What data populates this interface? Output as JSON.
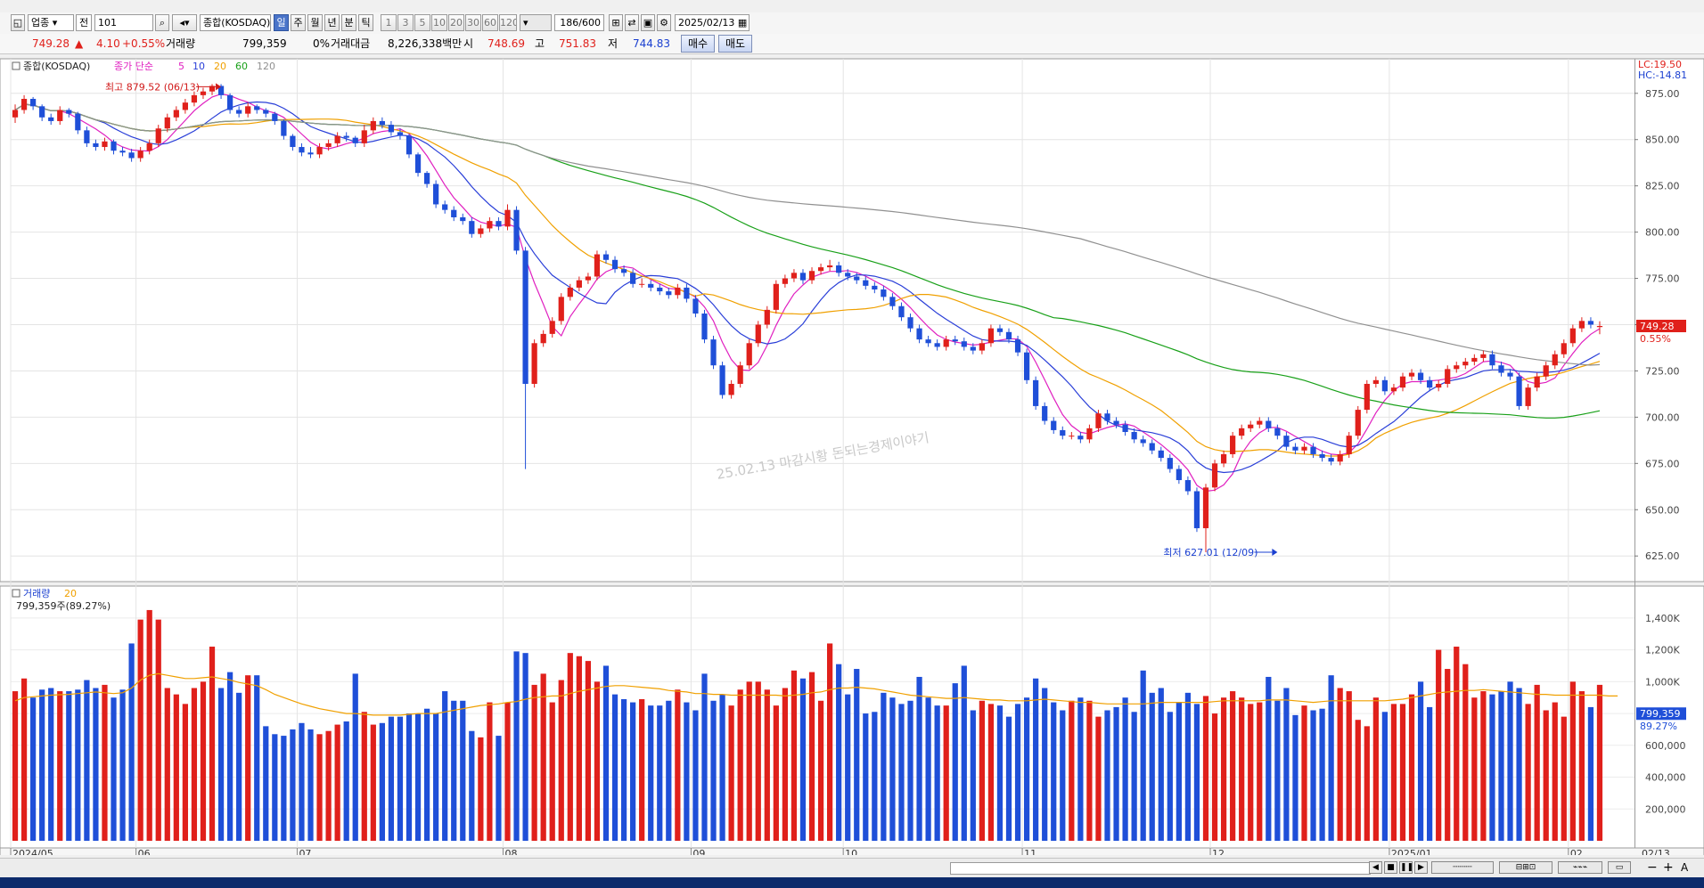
{
  "toolbar": {
    "market": "업종",
    "range": "전",
    "code": "101",
    "name": "종합(KOSDAQ)",
    "periods": [
      "일",
      "주",
      "월",
      "년",
      "분",
      "틱"
    ],
    "active_period": "일",
    "intervals": [
      "1",
      "3",
      "5",
      "10",
      "20",
      "30",
      "60",
      "120"
    ],
    "count": "186",
    "count_max": "/600",
    "date": "2025/02/13"
  },
  "quote": {
    "price": "749.28",
    "change": "4.10",
    "change_pct": "+0.55%",
    "volume_label": "거래량",
    "volume": "799,359",
    "volume_pct": "0%",
    "amount_label": "거래대금",
    "amount": "8,226,338백만",
    "open_label": "시",
    "open": "748.69",
    "high_label": "고",
    "high": "751.83",
    "low_label": "저",
    "low": "744.83",
    "buy": "매수",
    "sell": "매도"
  },
  "chart_data": [
    {
      "type": "candlestick",
      "title": "종합(KOSDAQ)",
      "ma_label": "종가 단순",
      "ma_periods": [
        {
          "name": "5",
          "color": "#e020c0"
        },
        {
          "name": "10",
          "color": "#2a3fd8"
        },
        {
          "name": "20",
          "color": "#f0a000"
        },
        {
          "name": "60",
          "color": "#18a018"
        },
        {
          "name": "120",
          "color": "#909090"
        }
      ],
      "up_color": "#e0201b",
      "down_color": "#1f4fd8",
      "ylim": [
        615,
        885
      ],
      "y_ticks": [
        625,
        650,
        675,
        700,
        725,
        750,
        775,
        800,
        825,
        850,
        875
      ],
      "y_tick_labels": [
        "625.00",
        "650.00",
        "675.00",
        "700.00",
        "725.00",
        "750.00",
        "775.00",
        "800.00",
        "825.00",
        "850.00",
        "875.00"
      ],
      "x_labels": [
        {
          "index": 0,
          "label": "2024/05"
        },
        {
          "index": 14,
          "label": "06"
        },
        {
          "index": 32,
          "label": "07"
        },
        {
          "index": 55,
          "label": "08"
        },
        {
          "index": 76,
          "label": "09"
        },
        {
          "index": 93,
          "label": "10"
        },
        {
          "index": 113,
          "label": "11"
        },
        {
          "index": 134,
          "label": "12"
        },
        {
          "index": 154,
          "label": "2025/01"
        },
        {
          "index": 174,
          "label": "02"
        }
      ],
      "x_end_label": "02/13",
      "lc": "LC:19.50",
      "hc": "HC:-14.81",
      "last_price": "749.28",
      "last_pct": "0.55%",
      "high_annotation": "최고 879.52 (06/13)",
      "high_annotation_index": 23,
      "high_annotation_value": 879.52,
      "low_annotation": "최저 627.01 (12/09)",
      "low_annotation_index": 141,
      "low_annotation_value": 627.01,
      "watermark": "25.02.13 마감시황 돈되는경제이야기",
      "close": [
        866,
        872,
        868,
        862,
        860,
        866,
        864,
        855,
        848,
        846,
        849,
        844,
        843,
        840,
        844,
        848,
        856,
        862,
        866,
        870,
        874,
        876,
        879,
        874,
        866,
        864,
        868,
        866,
        864,
        860,
        852,
        846,
        843,
        842,
        846,
        848,
        852,
        851,
        848,
        855,
        860,
        858,
        854,
        852,
        842,
        832,
        826,
        815,
        812,
        808,
        806,
        799,
        802,
        806,
        803,
        812,
        790,
        718,
        740,
        745,
        752,
        765,
        770,
        774,
        776,
        788,
        785,
        780,
        778,
        772,
        772,
        770,
        768,
        766,
        770,
        764,
        756,
        742,
        728,
        712,
        718,
        728,
        740,
        750,
        758,
        772,
        775,
        778,
        774,
        779,
        781,
        782,
        778,
        776,
        774,
        771,
        769,
        765,
        760,
        754,
        748,
        742,
        740,
        738,
        742,
        741,
        738,
        736,
        740,
        748,
        746,
        742,
        735,
        720,
        706,
        698,
        693,
        690,
        690,
        688,
        694,
        702,
        698,
        696,
        692,
        688,
        686,
        682,
        678,
        672,
        666,
        660,
        640,
        662,
        675,
        680,
        690,
        694,
        696,
        698,
        694,
        690,
        684,
        682,
        684,
        680,
        678,
        676,
        680,
        690,
        704,
        718,
        720,
        714,
        716,
        722,
        724,
        720,
        716,
        718,
        726,
        728,
        730,
        732,
        734,
        728,
        724,
        722,
        706,
        716,
        722,
        728,
        734,
        740,
        748,
        752,
        750,
        749.28
      ],
      "open": [
        862,
        866,
        872,
        868,
        862,
        860,
        866,
        864,
        855,
        848,
        846,
        849,
        844,
        843,
        840,
        844,
        848,
        856,
        862,
        866,
        870,
        874,
        876,
        879,
        874,
        866,
        864,
        868,
        866,
        864,
        860,
        852,
        846,
        843,
        842,
        846,
        848,
        852,
        851,
        848,
        855,
        860,
        858,
        854,
        852,
        842,
        832,
        826,
        815,
        812,
        808,
        806,
        799,
        802,
        806,
        803,
        812,
        790,
        718,
        740,
        745,
        752,
        765,
        770,
        774,
        776,
        788,
        785,
        780,
        778,
        772,
        772,
        770,
        768,
        766,
        770,
        764,
        756,
        742,
        728,
        712,
        718,
        728,
        740,
        750,
        758,
        772,
        775,
        778,
        774,
        779,
        781,
        782,
        778,
        776,
        774,
        771,
        769,
        765,
        760,
        754,
        748,
        742,
        740,
        738,
        742,
        741,
        738,
        736,
        740,
        748,
        746,
        742,
        735,
        720,
        706,
        698,
        693,
        690,
        690,
        688,
        694,
        702,
        698,
        696,
        692,
        688,
        686,
        682,
        678,
        672,
        666,
        660,
        640,
        662,
        675,
        680,
        690,
        694,
        696,
        698,
        694,
        690,
        684,
        682,
        684,
        680,
        678,
        676,
        680,
        690,
        704,
        718,
        720,
        714,
        716,
        722,
        724,
        720,
        716,
        718,
        726,
        728,
        730,
        732,
        734,
        728,
        724,
        722,
        706,
        716,
        722,
        728,
        734,
        740,
        748,
        752,
        748.69
      ],
      "high": [
        869,
        874,
        873,
        869,
        864,
        868,
        867,
        865,
        857,
        850,
        851,
        850,
        846,
        845,
        846,
        850,
        858,
        864,
        868,
        872,
        876,
        878,
        880,
        880,
        875,
        868,
        870,
        869,
        867,
        865,
        861,
        853,
        848,
        846,
        848,
        850,
        854,
        854,
        852,
        858,
        862,
        862,
        860,
        856,
        853,
        843,
        833,
        828,
        817,
        814,
        810,
        808,
        804,
        808,
        808,
        815,
        814,
        792,
        742,
        747,
        754,
        767,
        772,
        776,
        778,
        790,
        790,
        787,
        782,
        780,
        775,
        774,
        772,
        770,
        772,
        772,
        766,
        758,
        744,
        730,
        720,
        730,
        742,
        752,
        760,
        774,
        777,
        780,
        780,
        781,
        783,
        785,
        784,
        780,
        778,
        776,
        773,
        771,
        767,
        762,
        756,
        750,
        744,
        742,
        744,
        744,
        743,
        740,
        742,
        750,
        750,
        748,
        744,
        737,
        722,
        708,
        700,
        695,
        692,
        692,
        696,
        704,
        704,
        700,
        698,
        694,
        690,
        688,
        684,
        680,
        674,
        668,
        662,
        664,
        677,
        682,
        692,
        696,
        698,
        700,
        700,
        696,
        692,
        686,
        686,
        686,
        682,
        680,
        682,
        692,
        706,
        720,
        722,
        722,
        718,
        724,
        726,
        726,
        722,
        720,
        728,
        730,
        732,
        734,
        736,
        736,
        730,
        726,
        724,
        718,
        724,
        730,
        736,
        742,
        750,
        754,
        754,
        751.83
      ],
      "low": [
        859,
        864,
        866,
        860,
        858,
        858,
        862,
        853,
        846,
        844,
        844,
        842,
        841,
        838,
        838,
        842,
        846,
        854,
        860,
        864,
        868,
        872,
        874,
        872,
        864,
        862,
        862,
        864,
        862,
        858,
        850,
        844,
        841,
        840,
        840,
        844,
        846,
        849,
        846,
        846,
        853,
        856,
        852,
        850,
        840,
        830,
        824,
        813,
        810,
        806,
        804,
        797,
        797,
        800,
        801,
        801,
        788,
        672,
        716,
        738,
        743,
        750,
        763,
        768,
        772,
        774,
        783,
        778,
        776,
        770,
        770,
        768,
        766,
        764,
        764,
        762,
        754,
        740,
        726,
        710,
        710,
        716,
        726,
        738,
        748,
        756,
        770,
        773,
        772,
        772,
        777,
        779,
        776,
        774,
        772,
        769,
        767,
        763,
        758,
        752,
        746,
        740,
        738,
        736,
        736,
        739,
        736,
        734,
        734,
        738,
        744,
        740,
        733,
        718,
        704,
        696,
        691,
        688,
        688,
        686,
        686,
        692,
        696,
        694,
        690,
        686,
        684,
        680,
        676,
        670,
        664,
        658,
        638,
        627.01,
        660,
        673,
        678,
        688,
        692,
        694,
        692,
        688,
        682,
        680,
        680,
        678,
        676,
        674,
        674,
        678,
        688,
        702,
        716,
        712,
        712,
        714,
        720,
        718,
        714,
        714,
        716,
        724,
        726,
        728,
        730,
        726,
        722,
        720,
        704,
        704,
        714,
        720,
        726,
        732,
        738,
        746,
        748,
        744.83
      ],
      "volume": [
        940,
        1020,
        900,
        950,
        960,
        940,
        940,
        950,
        1010,
        960,
        980,
        900,
        950,
        1240,
        1390,
        1450,
        1390,
        960,
        920,
        860,
        960,
        1000,
        1220,
        960,
        1060,
        930,
        1040,
        1040,
        720,
        670,
        660,
        700,
        740,
        700,
        670,
        690,
        730,
        750,
        1050,
        810,
        730,
        740,
        780,
        780,
        800,
        800,
        830,
        800,
        940,
        880,
        880,
        690,
        650,
        870,
        660,
        870,
        1190,
        1180,
        980,
        1050,
        870,
        1010,
        1180,
        1160,
        1130,
        1000,
        1100,
        920,
        890,
        870,
        890,
        850,
        850,
        880,
        950,
        870,
        820,
        1050,
        880,
        920,
        850,
        950,
        1000,
        1000,
        950,
        850,
        960,
        1070,
        1020,
        1060,
        880,
        1240,
        1110,
        920,
        1080,
        800,
        810,
        930,
        900,
        860,
        880,
        1030,
        900,
        850,
        850,
        990,
        1100,
        820,
        880,
        860,
        850,
        780,
        860,
        900,
        1020,
        960,
        870,
        820,
        880,
        900,
        880,
        780,
        820,
        840,
        900,
        810,
        1070,
        930,
        960,
        810,
        870,
        930,
        860,
        910,
        800,
        900,
        940,
        900,
        860,
        870,
        1030,
        880,
        960,
        790,
        850,
        820,
        830,
        1040,
        960,
        940,
        760,
        720,
        900,
        810,
        860,
        860,
        920,
        1000,
        840,
        1200,
        1080,
        1220,
        1110,
        900,
        940,
        920,
        940,
        1000,
        960,
        860,
        980,
        820,
        870,
        780,
        1000,
        940,
        840,
        980,
        960,
        1010,
        980,
        900
      ],
      "volume_ma": [
        880,
        900,
        905,
        910,
        915,
        918,
        920,
        925,
        930,
        935,
        930,
        925,
        930,
        960,
        1010,
        1040,
        1050,
        1040,
        1030,
        1020,
        1020,
        1025,
        1030,
        1020,
        1010,
        995,
        985,
        975,
        950,
        920,
        900,
        880,
        860,
        845,
        830,
        820,
        810,
        800,
        800,
        795,
        790,
        790,
        790,
        790,
        795,
        800,
        800,
        800,
        810,
        820,
        830,
        840,
        850,
        855,
        860,
        870,
        875,
        890,
        900,
        905,
        910,
        910,
        925,
        940,
        950,
        960,
        970,
        975,
        975,
        970,
        965,
        960,
        955,
        945,
        940,
        935,
        925,
        925,
        920,
        920,
        915,
        915,
        915,
        915,
        915,
        915,
        910,
        915,
        920,
        930,
        935,
        950,
        960,
        960,
        965,
        960,
        955,
        945,
        935,
        925,
        915,
        910,
        905,
        900,
        895,
        895,
        900,
        895,
        890,
        885,
        885,
        880,
        880,
        880,
        885,
        890,
        885,
        880,
        875,
        870,
        870,
        865,
        860,
        860,
        860,
        860,
        860,
        865,
        870,
        870,
        870,
        870,
        870,
        870,
        875,
        880,
        880,
        880,
        880,
        880,
        885,
        885,
        885,
        880,
        875,
        870,
        875,
        880,
        880,
        880,
        880,
        880,
        880,
        880,
        885,
        890,
        900,
        910,
        920,
        930,
        935,
        940,
        945,
        945,
        950,
        945,
        940,
        935,
        930,
        925,
        920,
        920,
        915,
        915,
        915,
        915,
        915,
        915,
        910,
        910
      ],
      "vol_ylim": [
        0,
        1500
      ],
      "vol_ticks": [
        200,
        400,
        600,
        800,
        1000,
        1200,
        1400
      ],
      "vol_tick_labels": [
        "200,000",
        "400,000",
        "600,000",
        "800,000",
        "1,000K",
        "1,200K",
        "1,400K"
      ],
      "vol_title": "거래량",
      "vol_ma_label": "20",
      "vol_last_label": "799,359주(89.27%)",
      "vol_last_value": "799,359",
      "vol_last_pct": "89.27%"
    }
  ],
  "bottom": {
    "zoom_labels": [
      "−",
      "+",
      "A"
    ]
  }
}
